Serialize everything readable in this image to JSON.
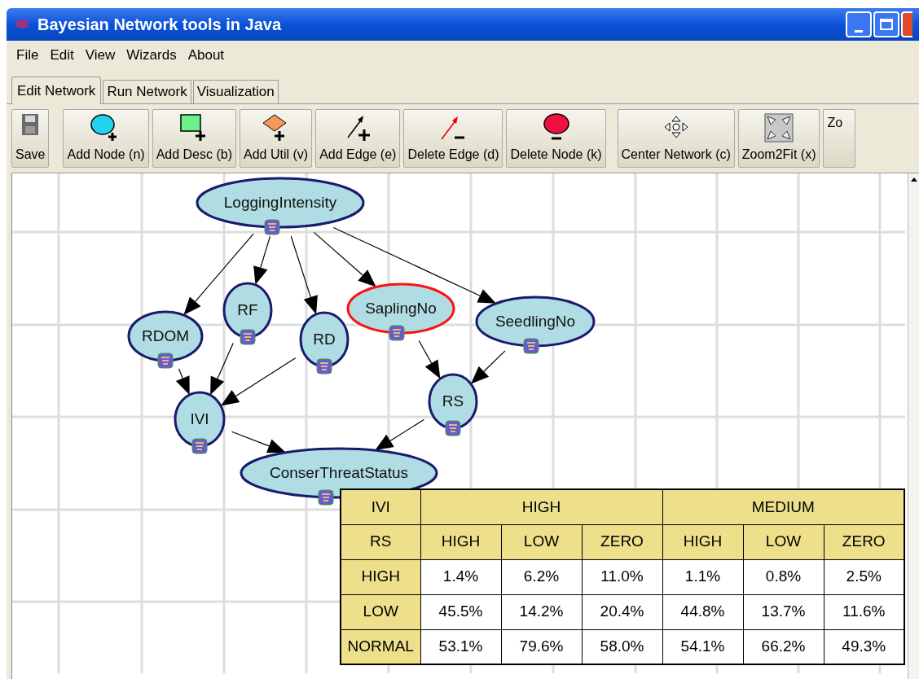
{
  "window": {
    "title": "Bayesian Network tools in Java"
  },
  "menu": [
    "File",
    "Edit",
    "View",
    "Wizards",
    "About"
  ],
  "tabs": [
    {
      "label": "Edit Network",
      "selected": true
    },
    {
      "label": "Run Network",
      "selected": false
    },
    {
      "label": "Visualization",
      "selected": false
    }
  ],
  "toolbar": [
    {
      "label": "Save",
      "kind": "save"
    },
    {
      "label": "Add Node (n)",
      "kind": "add-node"
    },
    {
      "label": "Add Desc (b)",
      "kind": "add-desc"
    },
    {
      "label": "Add Util (v)",
      "kind": "add-util"
    },
    {
      "label": "Add Edge (e)",
      "kind": "add-edge"
    },
    {
      "label": "Delete Edge (d)",
      "kind": "delete-edge"
    },
    {
      "label": "Delete Node (k)",
      "kind": "delete-node"
    },
    {
      "label": "Center Network (c)",
      "kind": "center"
    },
    {
      "label": "Zoom2Fit (x)",
      "kind": "zoom-fit"
    },
    {
      "label": "Zo",
      "kind": "cut"
    }
  ],
  "nodes": [
    {
      "label": "LoggingIntensity",
      "selected": false
    },
    {
      "label": "RF",
      "selected": false
    },
    {
      "label": "RDOM",
      "selected": false
    },
    {
      "label": "RD",
      "selected": false
    },
    {
      "label": "SaplingNo",
      "selected": true
    },
    {
      "label": "SeedlingNo",
      "selected": false
    },
    {
      "label": "IVI",
      "selected": false
    },
    {
      "label": "RS",
      "selected": false
    },
    {
      "label": "ConserThreatStatus",
      "selected": false
    }
  ],
  "table": {
    "parent_1": {
      "label": "IVI",
      "groups": [
        "HIGH",
        "MEDIUM"
      ]
    },
    "parent_2": {
      "label": "RS",
      "columns": [
        "HIGH",
        "LOW",
        "ZERO",
        "HIGH",
        "LOW",
        "ZERO"
      ]
    },
    "rows": [
      {
        "label": "HIGH",
        "values": [
          "1.4%",
          "6.2%",
          "11.0%",
          "1.1%",
          "0.8%",
          "2.5%"
        ]
      },
      {
        "label": "LOW",
        "values": [
          "45.5%",
          "14.2%",
          "20.4%",
          "44.8%",
          "13.7%",
          "11.6%"
        ]
      },
      {
        "label": "NORMAL",
        "values": [
          "53.1%",
          "79.6%",
          "58.0%",
          "54.1%",
          "66.2%",
          "49.3%"
        ]
      }
    ]
  }
}
